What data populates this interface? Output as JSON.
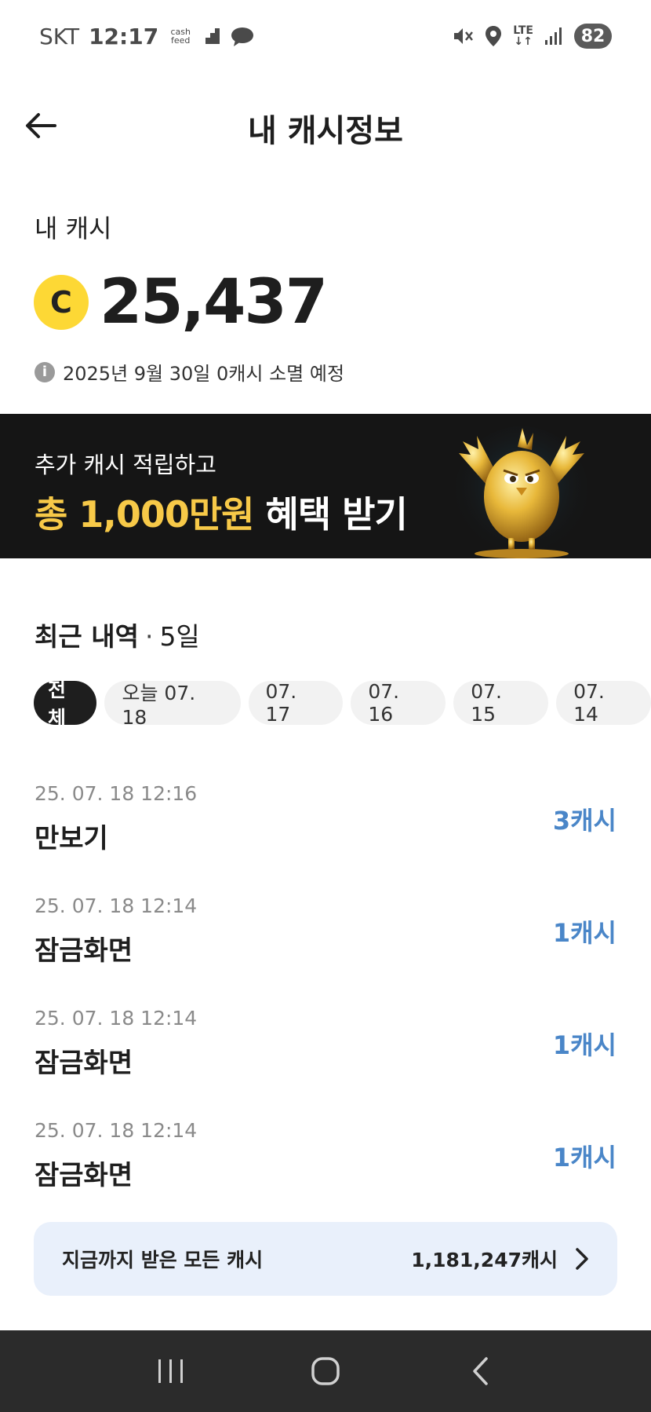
{
  "status_bar": {
    "carrier": "SKT",
    "time": "12:17",
    "app_badge_line1": "cash",
    "app_badge_line2": "feed",
    "network_line1": "LTE",
    "network_line2": "↓↑",
    "battery": "82"
  },
  "header": {
    "title": "내 캐시정보"
  },
  "cash": {
    "label": "내 캐시",
    "coin_symbol": "C",
    "amount": "25,437",
    "info_symbol": "i",
    "expire_notice": "2025년 9월 30일 0캐시 소멸 예정"
  },
  "banner": {
    "line1": "추가 캐시 적립하고",
    "line2_highlight": "총 1,000만원",
    "line2_rest": " 혜택 받기"
  },
  "recent": {
    "title": "최근 내역",
    "separator": "·",
    "period": "5일",
    "chips": [
      {
        "label": "전체",
        "active": true
      },
      {
        "label": "오늘 07. 18",
        "active": false
      },
      {
        "label": "07. 17",
        "active": false
      },
      {
        "label": "07. 16",
        "active": false
      },
      {
        "label": "07. 15",
        "active": false
      },
      {
        "label": "07. 14",
        "active": false
      }
    ]
  },
  "history": [
    {
      "time": "25. 07. 18 12:16",
      "title": "만보기",
      "amount": "3캐시"
    },
    {
      "time": "25. 07. 18 12:14",
      "title": "잠금화면",
      "amount": "1캐시"
    },
    {
      "time": "25. 07. 18 12:14",
      "title": "잠금화면",
      "amount": "1캐시"
    },
    {
      "time": "25. 07. 18 12:14",
      "title": "잠금화면",
      "amount": "1캐시"
    }
  ],
  "total": {
    "label": "지금까지 받은 모든 캐시",
    "value": "1,181,247캐시"
  },
  "icons": {
    "back": "arrow-left-icon",
    "coin": "cash-coin-icon",
    "info": "info-icon",
    "chevron": "chevron-right-icon",
    "nav_recent": "recent-apps-icon",
    "nav_home": "home-icon",
    "nav_back": "nav-back-icon"
  },
  "colors": {
    "accent_blue": "#4a86c8",
    "coin_yellow": "#fdd835",
    "banner_gold": "#f7c948",
    "banner_bg": "#151515",
    "total_bg": "#e9f0fb"
  }
}
